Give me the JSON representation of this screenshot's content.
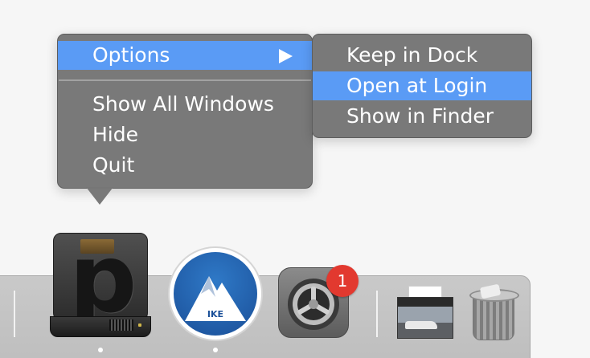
{
  "context_menu": {
    "items": [
      {
        "label": "Options",
        "has_submenu": true,
        "selected": true
      },
      {
        "label": "Show All Windows"
      },
      {
        "label": "Hide"
      },
      {
        "label": "Quit"
      }
    ]
  },
  "submenu": {
    "items": [
      {
        "label": "Keep in Dock"
      },
      {
        "label": "Open at Login",
        "selected": true
      },
      {
        "label": "Show in Finder"
      }
    ]
  },
  "dock": {
    "apps": [
      {
        "name": "plex-drive",
        "icon": "plex-drive-icon",
        "running": true
      },
      {
        "name": "vpn",
        "icon": "vpn-icon",
        "badge_text": "IKE",
        "running": true
      },
      {
        "name": "system-preferences",
        "icon": "system-preferences-icon",
        "notification_count": "1",
        "running": false
      },
      {
        "name": "downloads-stack",
        "icon": "stack-icon"
      },
      {
        "name": "trash",
        "icon": "trash-icon"
      }
    ]
  },
  "colors": {
    "menu_bg": "#767676",
    "selection": "#5a9bf5",
    "badge_red": "#e2392f",
    "dock_bg": "#c4c4c4"
  }
}
